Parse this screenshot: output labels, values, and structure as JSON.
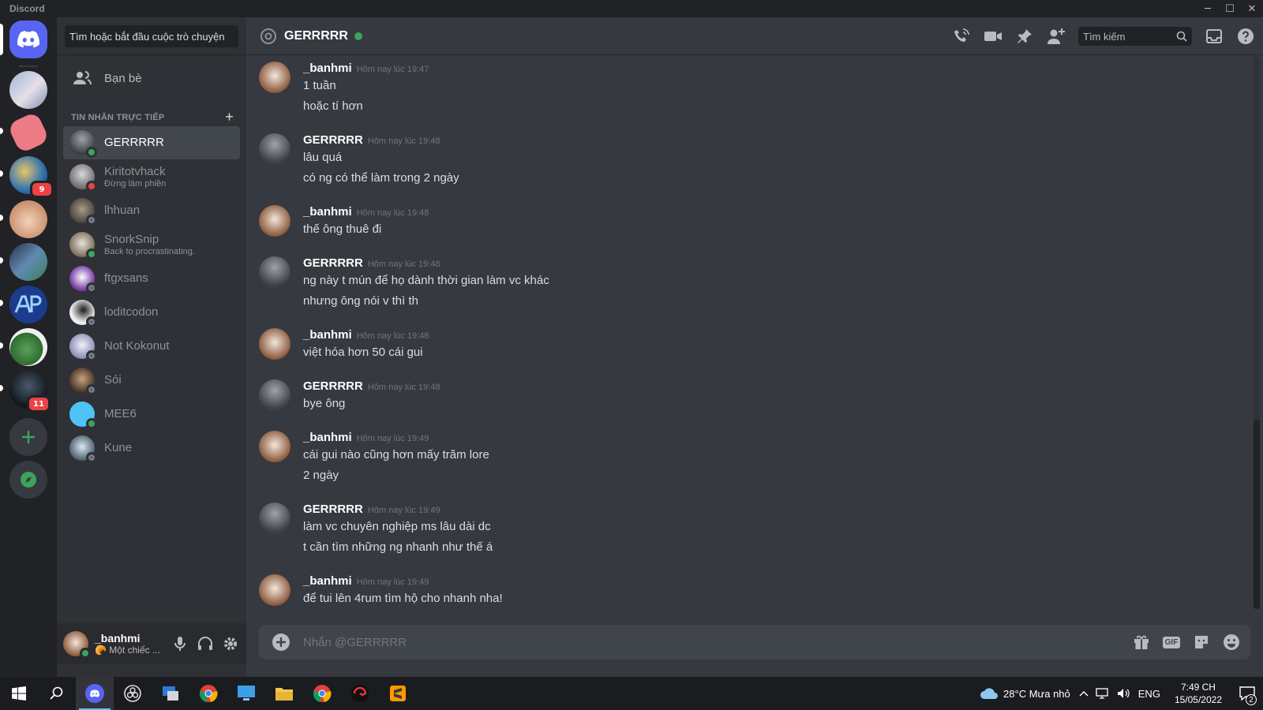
{
  "window": {
    "app_name": "Discord",
    "minimize": "─",
    "maximize": "☐",
    "close": "✕"
  },
  "guilds": {
    "badge_1": "9",
    "badge_2": "11",
    "add_label": "+"
  },
  "sidebar": {
    "search_placeholder": "Tìm hoặc bắt đầu cuộc trò chuyện",
    "friends_label": "Bạn bè",
    "dm_header": "TIN NHẮN TRỰC TIẾP",
    "dm_add": "+",
    "dms": [
      {
        "name": "GERRRRR",
        "sub": "",
        "status": "online"
      },
      {
        "name": "Kiritotvhack",
        "sub": "Đừng làm phiền",
        "status": "dnd"
      },
      {
        "name": "lhhuan",
        "sub": "",
        "status": "offline"
      },
      {
        "name": "SnorkSnip",
        "sub": "Back to procrastinating.",
        "status": "online"
      },
      {
        "name": "ftgxsans",
        "sub": "",
        "status": "offline"
      },
      {
        "name": "loditcodon",
        "sub": "",
        "status": "offline"
      },
      {
        "name": "Not Kokonut",
        "sub": "",
        "status": "offline"
      },
      {
        "name": "Sói",
        "sub": "",
        "status": "offline"
      },
      {
        "name": "MEE6",
        "sub": "",
        "status": "online"
      },
      {
        "name": "Kune",
        "sub": "",
        "status": "offline"
      }
    ]
  },
  "user_panel": {
    "username": "_banhmi",
    "status": "🥐 Một chiếc ..."
  },
  "header": {
    "channel_name": "GERRRRR",
    "search_placeholder": "Tìm kiếm"
  },
  "messages": [
    {
      "author": "_banhmi",
      "time": "Hôm nay lúc 19:47",
      "lines": [
        "1 tuần",
        "hoặc tí hơn"
      ]
    },
    {
      "author": "GERRRRR",
      "time": "Hôm nay lúc 19:48",
      "lines": [
        "lâu quá",
        "có ng có thể làm trong 2 ngày"
      ]
    },
    {
      "author": "_banhmi",
      "time": "Hôm nay lúc 19:48",
      "lines": [
        "thế ông thuê đi"
      ]
    },
    {
      "author": "GERRRRR",
      "time": "Hôm nay lúc 19:48",
      "lines": [
        "ng này t mún để họ dành thời gian làm vc khác",
        "nhưng ông nói v thì th"
      ]
    },
    {
      "author": "_banhmi",
      "time": "Hôm nay lúc 19:48",
      "lines": [
        "việt hóa hơn 50 cái gui"
      ]
    },
    {
      "author": "GERRRRR",
      "time": "Hôm nay lúc 19:48",
      "lines": [
        "bye ông"
      ]
    },
    {
      "author": "_banhmi",
      "time": "Hôm nay lúc 19:49",
      "lines": [
        "cái gui nào cũng hơn mấy trăm lore",
        "2 ngày"
      ]
    },
    {
      "author": "GERRRRR",
      "time": "Hôm nay lúc 19:49",
      "lines": [
        "làm vc chuyên nghiệp ms lâu dài dc",
        "t cần tìm những ng nhanh như thế á"
      ]
    },
    {
      "author": "_banhmi",
      "time": "Hôm nay lúc 19:49",
      "lines": [
        "để tui lên 4rum tìm hộ cho nhanh nha!"
      ]
    }
  ],
  "composer": {
    "placeholder": "Nhắn @GERRRRR",
    "gif_label": "GIF"
  },
  "taskbar": {
    "weather": "28°C  Mưa nhỏ",
    "language": "ENG",
    "time": "7:49 CH",
    "date": "15/05/2022",
    "notifications": "2"
  },
  "colors": {
    "blurple": "#5865f2",
    "online": "#3ba55d",
    "dnd": "#ed4245",
    "background": "#36393f"
  }
}
